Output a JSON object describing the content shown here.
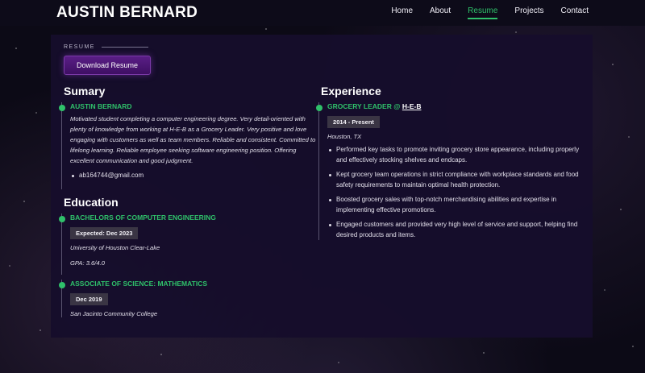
{
  "header": {
    "brand": "AUSTIN BERNARD",
    "nav": [
      "Home",
      "About",
      "Resume",
      "Projects",
      "Contact"
    ],
    "active_nav": "Resume"
  },
  "resume": {
    "tag": "RESUME",
    "download_label": "Download Resume"
  },
  "summary": {
    "heading": "Sumary",
    "name": "AUSTIN BERNARD",
    "text": "Motivated student completing a computer engineering degree. Very detail-oriented with plenty of knowledge from working at H-E-B as a Grocery Leader. Very positive and love engaging with customers as well as team members. Reliable and consistent. Committed to lifelong learning. Reliable employee seeking software engineering position. Offering excellent communication and good judgment.",
    "email": "ab164744@gmail.com"
  },
  "education": {
    "heading": "Education",
    "items": [
      {
        "title": "BACHELORS OF COMPUTER ENGINEERING",
        "date": "Expected: Dec 2023",
        "school": "University of Houston Clear-Lake",
        "gpa": "GPA: 3.6/4.0"
      },
      {
        "title": "ASSOCIATE OF SCIENCE: MATHEMATICS",
        "date": "Dec 2019",
        "school": "San Jacinto Community College"
      }
    ]
  },
  "experience": {
    "heading": "Experience",
    "title_prefix": "GROCERY LEADER @ ",
    "employer": "H-E-B",
    "date": "2014 - Present",
    "location": "Houston, TX",
    "bullets": [
      "Performed key tasks to promote inviting grocery store appearance, including properly and effectively stocking shelves and endcaps.",
      "Kept grocery team operations in strict compliance with workplace standards and food safety requirements to maintain optimal health protection.",
      "Boosted grocery sales with top-notch merchandising abilities and expertise in implementing effective promotions.",
      "Engaged customers and provided very high level of service and support, helping find desired products and items."
    ]
  },
  "colors": {
    "accent": "#2fc06a",
    "panel": "#160e2c",
    "button": "#4a1772"
  }
}
